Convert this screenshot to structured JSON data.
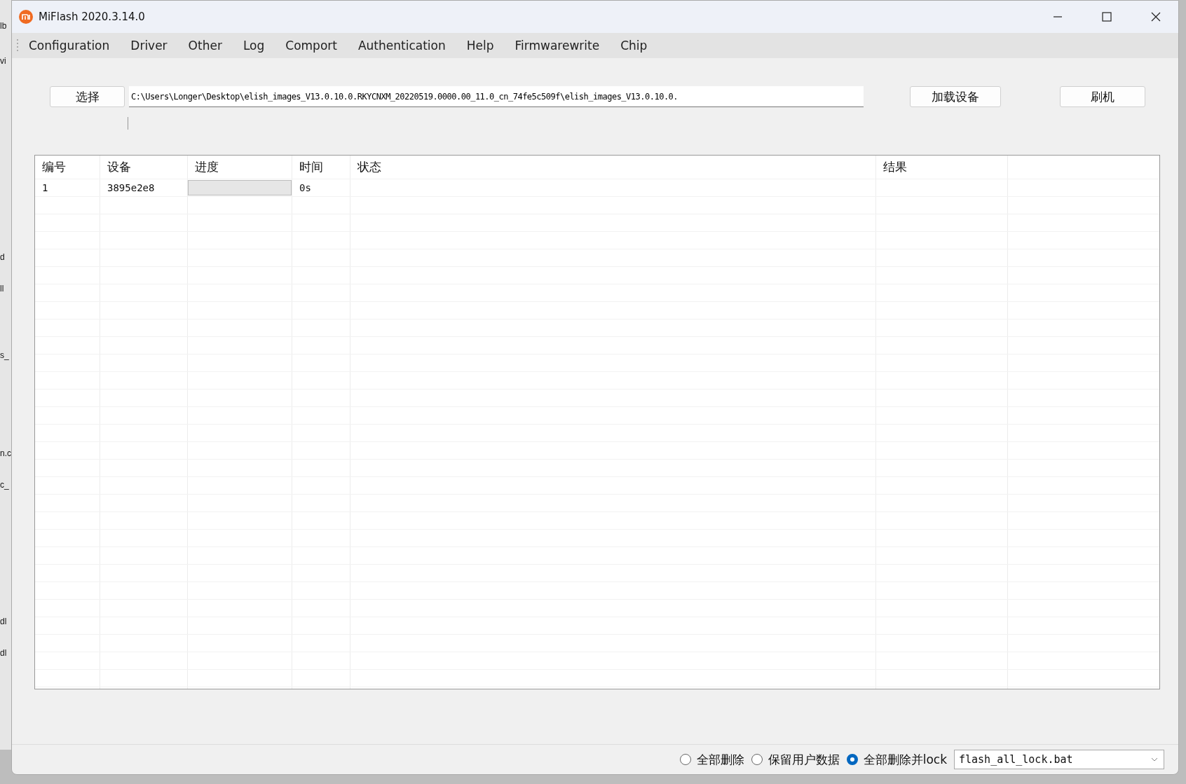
{
  "background_fragments": [
    "lb",
    "vi",
    "d",
    "ll",
    "s_",
    "n.c",
    "c_",
    "dl",
    "dl"
  ],
  "window": {
    "title": "MiFlash 2020.3.14.0"
  },
  "menu": [
    "Configuration",
    "Driver",
    "Other",
    "Log",
    "Comport",
    "Authentication",
    "Help",
    "Firmwarewrite",
    "Chip"
  ],
  "toolbar": {
    "select_button": "选择",
    "path": "C:\\Users\\Longer\\Desktop\\elish_images_V13.0.10.0.RKYCNXM_20220519.0000.00_11.0_cn_74fe5c509f\\elish_images_V13.0.10.0.",
    "load_button": "加载设备",
    "flash_button": "刷机"
  },
  "table": {
    "columns": [
      "编号",
      "设备",
      "进度",
      "时间",
      "状态",
      "结果"
    ],
    "rows": [
      {
        "number": "1",
        "device": "3895e2e8",
        "progress": {
          "level": 0
        },
        "time": "0s"
      }
    ]
  },
  "options": [
    {
      "label": "全部删除",
      "selected": false
    },
    {
      "label": "保留用户数据",
      "selected": false
    },
    {
      "label": "全部删除并lock",
      "selected": true
    }
  ],
  "script_select": {
    "value": "flash_all_lock.bat"
  }
}
